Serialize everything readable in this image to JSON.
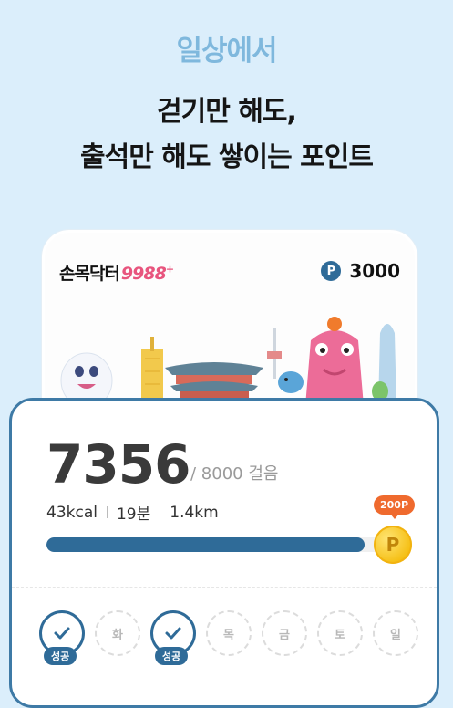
{
  "hero": {
    "eyebrow": "일상에서",
    "headline_line1": "걷기만 해도,",
    "headline_line2": "출석만 해도 쌓이는 포인트"
  },
  "app_card": {
    "brand_text": "손목닥터",
    "brand_number": "9988",
    "brand_plus": "+",
    "points_icon_label": "P",
    "points_value": "3000"
  },
  "steps": {
    "count": "7356",
    "goal_text": "/ 8000 걸음",
    "progress_fraction": 0.9195,
    "calories": "43kcal",
    "duration": "19분",
    "distance": "1.4km",
    "reward_badge": "200P",
    "coin_label": "P"
  },
  "week": [
    {
      "label": "",
      "done": true,
      "tag": "성공"
    },
    {
      "label": "화",
      "done": false,
      "tag": ""
    },
    {
      "label": "",
      "done": true,
      "tag": "성공"
    },
    {
      "label": "목",
      "done": false,
      "tag": ""
    },
    {
      "label": "금",
      "done": false,
      "tag": ""
    },
    {
      "label": "토",
      "done": false,
      "tag": ""
    },
    {
      "label": "일",
      "done": false,
      "tag": ""
    }
  ],
  "colors": {
    "background": "#dbeefb",
    "accent": "#2f6b98",
    "brand_pink": "#e8557e",
    "reward_orange": "#ef6a2e",
    "coin_gold": "#f5bf14"
  }
}
